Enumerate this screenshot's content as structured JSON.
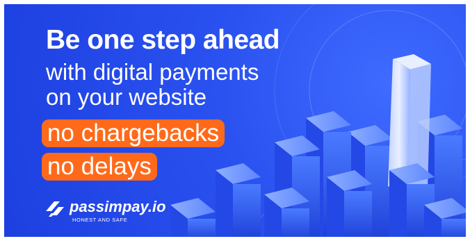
{
  "ad": {
    "headline": "Be one step ahead",
    "subline_1": "with digital payments",
    "subline_2": "on your website",
    "badge_1": "no chargebacks",
    "badge_2": "no delays"
  },
  "brand": {
    "logo_icon": "passimpay-logo-icon",
    "name": "passimpay.io",
    "tagline": "HONEST AND SAFE"
  },
  "colors": {
    "background": "#2a52f0",
    "badge": "#ff6a1a",
    "text": "#ffffff"
  }
}
